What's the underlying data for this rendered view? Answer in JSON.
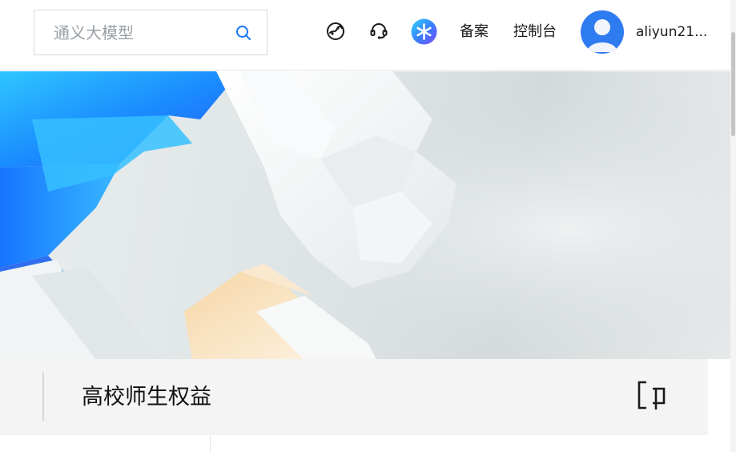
{
  "header": {
    "search": {
      "placeholder": "通义大模型",
      "icon": "search-icon"
    },
    "icons": [
      {
        "name": "network-globe-icon"
      },
      {
        "name": "headset-support-icon"
      },
      {
        "name": "ai-assistant-sparkle-icon"
      }
    ],
    "links": {
      "beian": "备案",
      "console": "控制台"
    },
    "user": {
      "avatar": "user-avatar",
      "name": "aliyun21..."
    }
  },
  "banner": {
    "accent_colors": [
      "#1a8cff",
      "#2c5cff",
      "#f2d3a8",
      "#eceff0"
    ]
  },
  "section": {
    "title": "高校师生权益",
    "icon": "bracket-frame-icon"
  }
}
